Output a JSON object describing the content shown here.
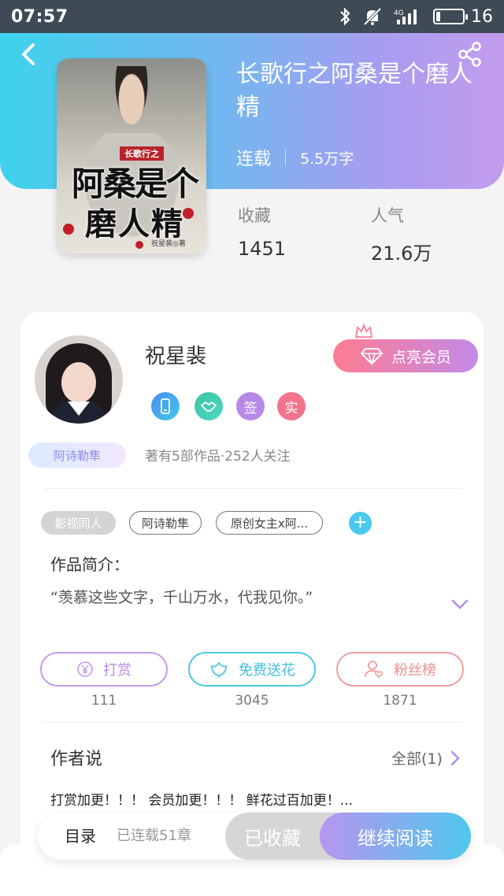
{
  "status_bar": {
    "time": "07:57",
    "network": "4G",
    "battery": "16"
  },
  "book": {
    "title": "长歌行之阿桑是个磨人精",
    "status": "连载",
    "word_count": "5.5万字",
    "cover": {
      "tag": "长歌行之",
      "title_line1": "阿桑是个",
      "title_line2": "磨人精",
      "author": "祝星裴◎著"
    },
    "stats": [
      {
        "label": "收藏",
        "value": "1451"
      },
      {
        "label": "人气",
        "value": "21.6万"
      }
    ]
  },
  "author": {
    "name": "祝星裴",
    "vip_button": "点亮会员",
    "badges": [
      "签",
      "实"
    ],
    "fan_badge": "阿诗勒隼",
    "stats": "著有5部作品·252人关注"
  },
  "tags": [
    "影视同人",
    "阿诗勒隼",
    "原创女主x阿..."
  ],
  "intro": {
    "title": "作品简介：",
    "text": "“羡慕这些文字，千山万水，代我见你。”"
  },
  "actions": [
    {
      "label": "打赏",
      "count": "111",
      "color": "#c49aeb",
      "icon": "yuan-icon"
    },
    {
      "label": "免费送花",
      "count": "3045",
      "color": "#4fc8e6",
      "icon": "flower-icon"
    },
    {
      "label": "粉丝榜",
      "count": "1871",
      "color": "#f29b9b",
      "icon": "fan-icon"
    }
  ],
  "author_says": {
    "title": "作者说",
    "all_label": "全部(1)",
    "text": "打赏加更！！！ 会员加更！！！ 鲜花过百加更！..."
  },
  "bottom_bar": {
    "toc_label": "目录",
    "chapters": "已连载51章",
    "collected_label": "已收藏",
    "continue_label": "继续阅读"
  }
}
